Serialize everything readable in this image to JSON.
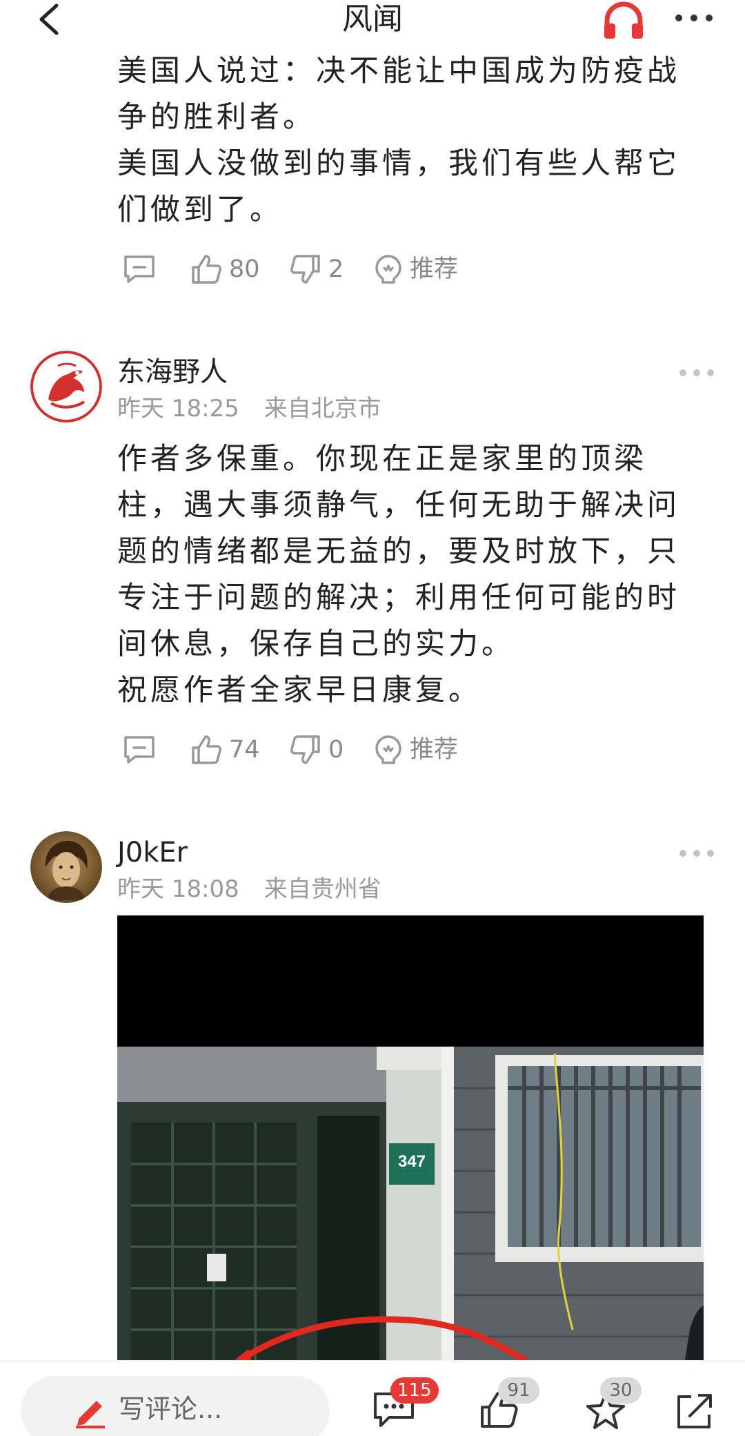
{
  "header": {
    "title": "风闻"
  },
  "comments": [
    {
      "text_lines": [
        "美国人说过：决不能让中国成为防疫战",
        "争的胜利者。",
        "美国人没做到的事情，我们有些人帮它",
        "们做到了。"
      ],
      "likes": "80",
      "dislikes": "2",
      "recommend_label": "推荐"
    },
    {
      "username": "东海野人",
      "time": "昨天 18:25",
      "location": "来自北京市",
      "text_lines": [
        "作者多保重。你现在正是家里的顶梁",
        "柱，遇大事须静气，任何无助于解决问",
        "题的情绪都是无益的，要及时放下，只",
        "专注于问题的解决；利用任何可能的时",
        "间休息，保存自己的实力。",
        "祝愿作者全家早日康复。"
      ],
      "likes": "74",
      "dislikes": "0",
      "recommend_label": "推荐"
    },
    {
      "username": "J0kEr",
      "time": "昨天 18:08",
      "location": "来自贵州省",
      "image": {
        "house_number": "347"
      }
    }
  ],
  "bottom_bar": {
    "compose_placeholder": "写评论...",
    "comment_count": "115",
    "like_count": "91",
    "favorite_count": "30"
  },
  "colors": {
    "accent": "#e53935",
    "muted": "#9a9a9a"
  }
}
